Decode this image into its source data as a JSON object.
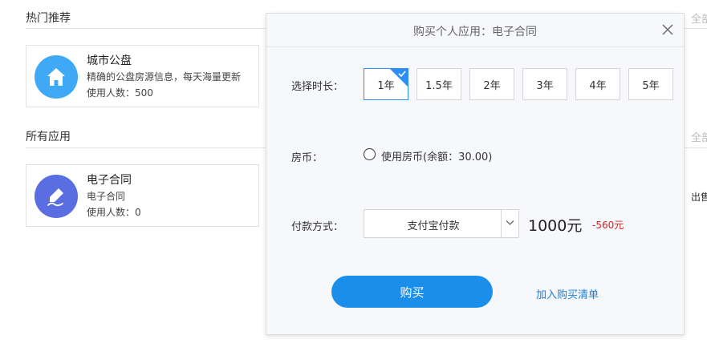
{
  "background": {
    "hot_section": {
      "title": "热门推荐",
      "see_all": "全部",
      "card": {
        "name": "城市公盘",
        "description": "精确的公盘房源信息，每天海量更新",
        "users": "使用人数：500",
        "icon": "house-icon",
        "icon_color": "#3fa9f5"
      }
    },
    "all_section": {
      "title": "所有应用",
      "see_all": "全部",
      "card": {
        "name": "电子合同",
        "description": "电子合同",
        "users": "使用人数：0",
        "icon": "pen-icon",
        "icon_color": "#5b6ee1"
      }
    },
    "side_text": "出售"
  },
  "modal": {
    "title": "购买个人应用：电子合同",
    "duration": {
      "label": "选择时长：",
      "options": [
        "1年",
        "1.5年",
        "2年",
        "3年",
        "4年",
        "5年"
      ],
      "selected_index": 0
    },
    "coins": {
      "label": "房币：",
      "option_label": "使用房币(余额：30.00)",
      "checked": false
    },
    "payment": {
      "label": "付款方式：",
      "selected": "支付宝付款",
      "price": "1000元",
      "discount": "-560元"
    },
    "buy_label": "购买",
    "cart_label": "加入购买清单",
    "accent_color": "#1a8ee8"
  }
}
